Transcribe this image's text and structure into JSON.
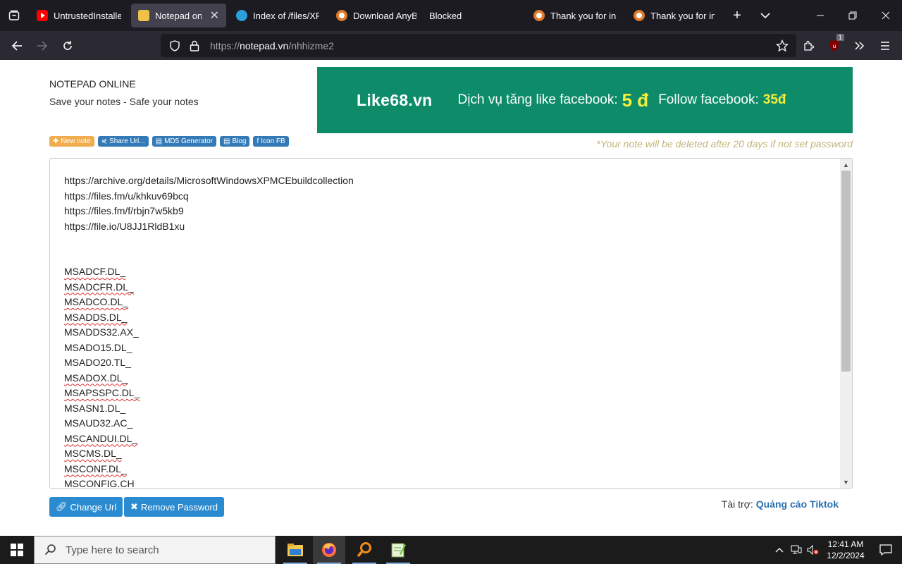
{
  "browser": {
    "tabs": [
      {
        "title": "UntrustedInstaller",
        "favicon": "youtube-icon",
        "active": false
      },
      {
        "title": "Notepad online",
        "favicon": "notepad-icon",
        "active": true
      },
      {
        "title": "Index of /files/XP",
        "favicon": "globe-icon",
        "active": false
      },
      {
        "title": "Download AnyBu",
        "favicon": "anyrun-icon",
        "active": false
      },
      {
        "title": "Blocked",
        "favicon": "",
        "active": false
      },
      {
        "title": "Thank you for inst",
        "favicon": "anyrun-icon",
        "active": false
      },
      {
        "title": "Thank you for inst",
        "favicon": "anyrun-icon",
        "active": false
      }
    ],
    "url_scheme": "https://",
    "url_host": "notepad.vn",
    "url_path": "/nhhizme2",
    "ublock_badge": "1"
  },
  "page": {
    "site_title": "NOTEPAD ONLINE",
    "site_subtitle": "Save your notes - Safe your notes",
    "ad": {
      "brand": "Like68.vn",
      "text1": "Dịch vụ tăng like facebook:",
      "price1": "5 đ",
      "text2": "Follow facebook:",
      "price2": "35đ"
    },
    "chips": [
      {
        "label": "New note",
        "icon": "plus-icon",
        "color": "orange"
      },
      {
        "label": "Share Url...",
        "icon": "share-icon",
        "color": "blue"
      },
      {
        "label": "MD5 Generator",
        "icon": "document-icon",
        "color": "blue"
      },
      {
        "label": "Blog",
        "icon": "document-icon",
        "color": "blue"
      },
      {
        "label": "Icon FB",
        "icon": "facebook-icon",
        "color": "blue"
      }
    ],
    "notice": "*Your note will be deleted after 20 days if not set password",
    "editor_lines": [
      {
        "text": "https://archive.org/details/MicrosoftWindowsXPMCEbuildcollection",
        "spell": false
      },
      {
        "text": "https://files.fm/u/khkuv69bcq",
        "spell": false
      },
      {
        "text": "https://files.fm/f/rbjn7w5kb9",
        "spell": false
      },
      {
        "text": "https://file.io/U8JJ1RldB1xu",
        "spell": false
      },
      {
        "text": "",
        "spell": false
      },
      {
        "text": "",
        "spell": false
      },
      {
        "text": "MSADCF.DL_",
        "spell": true
      },
      {
        "text": "MSADCFR.DL_",
        "spell": true
      },
      {
        "text": "MSADCO.DL_",
        "spell": true
      },
      {
        "text": "MSADDS.DL_",
        "spell": true
      },
      {
        "text": "MSADDS32.AX_",
        "spell": false
      },
      {
        "text": "MSADO15.DL_",
        "spell": false
      },
      {
        "text": "MSADO20.TL_",
        "spell": false
      },
      {
        "text": "MSADOX.DL_",
        "spell": true
      },
      {
        "text": "MSAPSSPC.DL_",
        "spell": true
      },
      {
        "text": "MSASN1.DL_",
        "spell": false
      },
      {
        "text": "MSAUD32.AC_",
        "spell": false
      },
      {
        "text": "MSCANDUI.DL_",
        "spell": true
      },
      {
        "text": "MSCMS.DL_",
        "spell": true
      },
      {
        "text": "MSCONF.DL_",
        "spell": true
      },
      {
        "text": "MSCONFIG.CH",
        "spell": false
      }
    ],
    "buttons": {
      "change_url": "Change Url",
      "remove_password": "Remove Password"
    },
    "sponsor": {
      "label": "Tài trợ:",
      "link": "Quảng cáo Tiktok"
    }
  },
  "taskbar": {
    "search_placeholder": "Type here to search",
    "apps": [
      "file-explorer-icon",
      "firefox-icon",
      "search-app-icon",
      "notepad-plus-icon"
    ],
    "time": "12:41 AM",
    "date": "12/2/2024"
  },
  "colors": {
    "ad_green": "#0e8c6a",
    "ad_yellow": "#f5ef3a",
    "button_blue": "#2a8bd0",
    "chip_orange": "#f0ad4e",
    "chip_blue": "#337ab7",
    "notice_tan": "#c4b478"
  }
}
